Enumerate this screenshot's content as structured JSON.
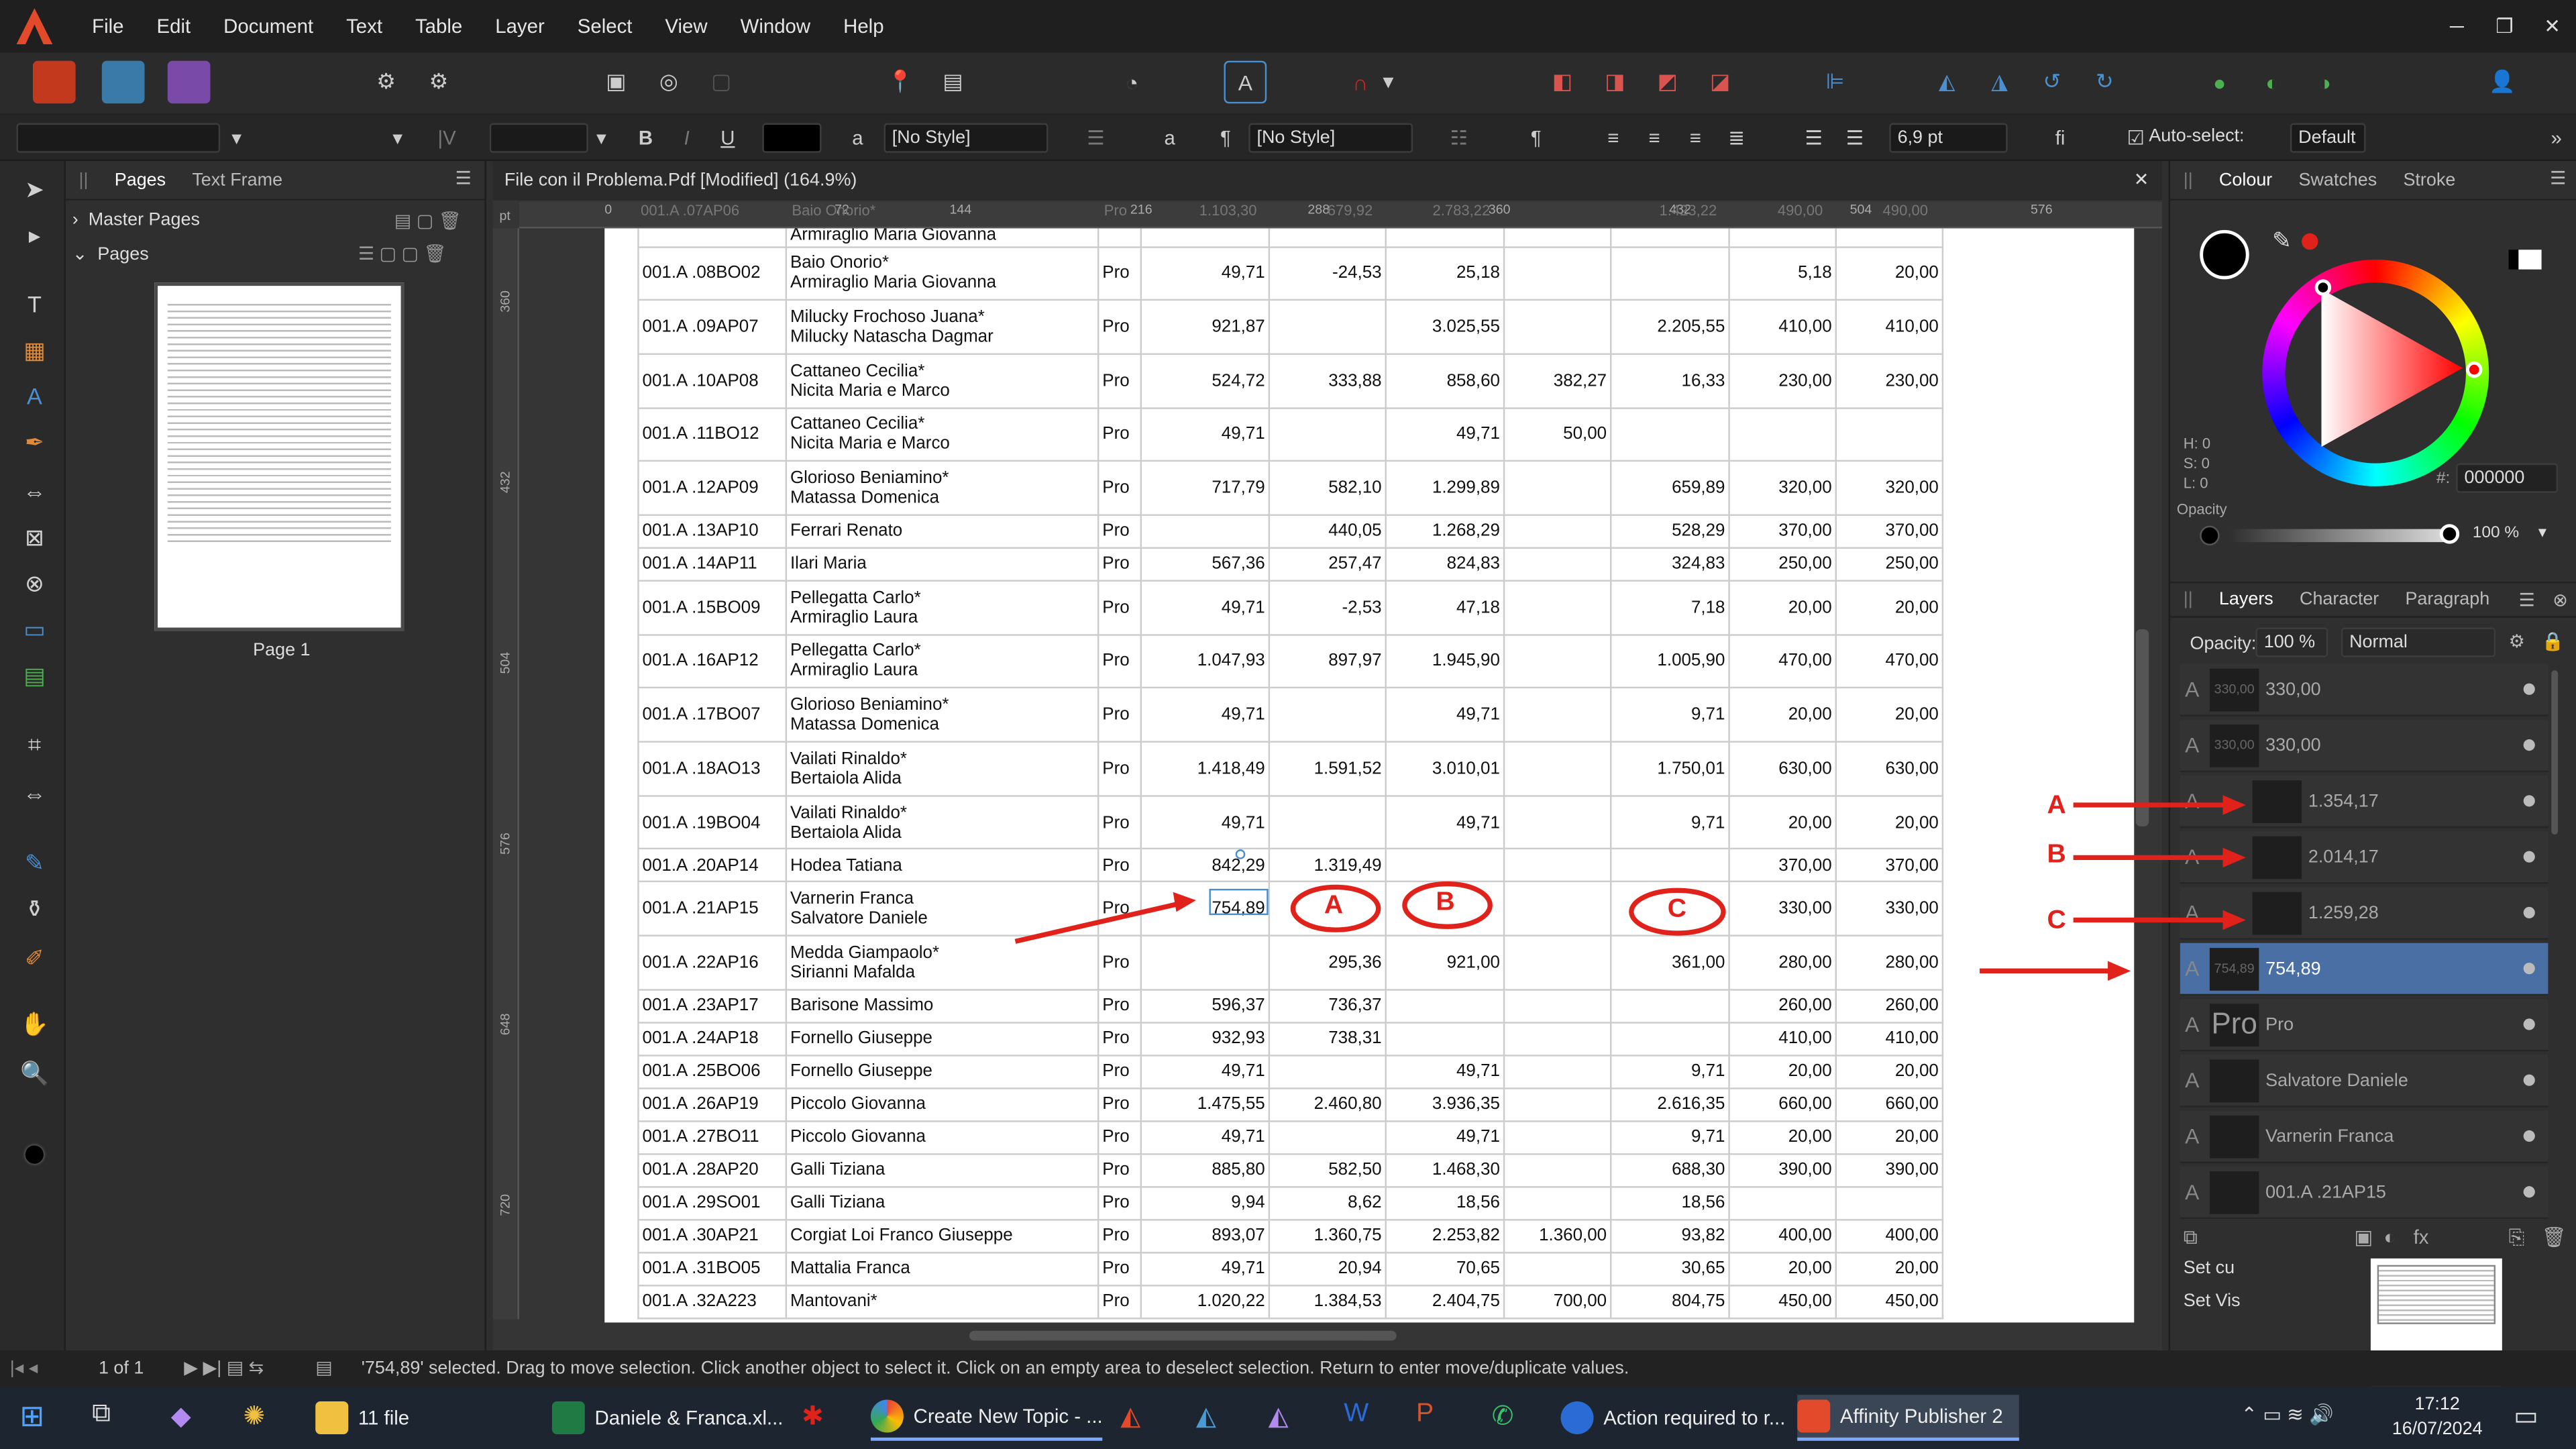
{
  "menu": {
    "items": [
      "File",
      "Edit",
      "Document",
      "Text",
      "Table",
      "Layer",
      "Select",
      "View",
      "Window",
      "Help"
    ]
  },
  "context": {
    "style1": "[No Style]",
    "style2": "[No Style]",
    "font_size": "6,9 pt",
    "autoselect_label": "Auto-select:",
    "autoselect_value": "Default"
  },
  "left_panel": {
    "tab1": "Pages",
    "tab2": "Text Frame",
    "master": "Master Pages",
    "pages": "Pages",
    "page_label": "Page 1"
  },
  "document": {
    "title": "File con il Problema.Pdf [Modified] (164.9%)",
    "ruler_unit": "pt",
    "hruler": [
      "0",
      "72",
      "144",
      "216",
      "288",
      "360",
      "432",
      "504",
      "576"
    ],
    "vruler": [
      "360",
      "432",
      "504",
      "576",
      "648",
      "720"
    ],
    "top_strip": [
      "001.A .07AP06",
      "Baio Onorio*",
      "Pro",
      "1.103,30",
      "679,92",
      "2.783,22",
      "1.423,22",
      "490,00",
      "490,00"
    ]
  },
  "table": {
    "rows": [
      {
        "code": "",
        "name1": "Armiraglio Maria Giovanna",
        "name2": "",
        "pro": "",
        "c1": "",
        "c2": "",
        "c3": "",
        "c4": "",
        "c5": "",
        "c6": "",
        "c7": ""
      },
      {
        "code": "001.A .08BO02",
        "name1": "Baio Onorio*",
        "name2": "Armiraglio Maria Giovanna",
        "pro": "Pro",
        "c1": "49,71",
        "c2": "-24,53",
        "c3": "25,18",
        "c4": "",
        "c5": "",
        "c6": "5,18",
        "c7": "20,00"
      },
      {
        "code": "001.A .09AP07",
        "name1": "Milucky Frochoso Juana*",
        "name2": "Milucky Natascha Dagmar",
        "pro": "Pro",
        "c1": "921,87",
        "c2": "",
        "c3": "3.025,55",
        "c4": "",
        "c5": "2.205,55",
        "c6": "410,00",
        "c7": "410,00"
      },
      {
        "code": "001.A .10AP08",
        "name1": "Cattaneo Cecilia*",
        "name2": "Nicita Maria e Marco",
        "pro": "Pro",
        "c1": "524,72",
        "c2": "333,88",
        "c3": "858,60",
        "c4": "382,27",
        "c5": "16,33",
        "c6": "230,00",
        "c7": "230,00"
      },
      {
        "code": "001.A .11BO12",
        "name1": "Cattaneo Cecilia*",
        "name2": "Nicita Maria e Marco",
        "pro": "Pro",
        "c1": "49,71",
        "c2": "",
        "c3": "49,71",
        "c4": "50,00",
        "c5": "",
        "c6": "",
        "c7": ""
      },
      {
        "code": "001.A .12AP09",
        "name1": "Glorioso Beniamino*",
        "name2": "Matassa Domenica",
        "pro": "Pro",
        "c1": "717,79",
        "c2": "582,10",
        "c3": "1.299,89",
        "c4": "",
        "c5": "659,89",
        "c6": "320,00",
        "c7": "320,00"
      },
      {
        "code": "001.A .13AP10",
        "name1": "Ferrari Renato",
        "name2": "",
        "pro": "Pro",
        "c1": "",
        "c2": "440,05",
        "c3": "1.268,29",
        "c4": "",
        "c5": "528,29",
        "c6": "370,00",
        "c7": "370,00"
      },
      {
        "code": "001.A .14AP11",
        "name1": "Ilari Maria",
        "name2": "",
        "pro": "Pro",
        "c1": "567,36",
        "c2": "257,47",
        "c3": "824,83",
        "c4": "",
        "c5": "324,83",
        "c6": "250,00",
        "c7": "250,00"
      },
      {
        "code": "001.A .15BO09",
        "name1": "Pellegatta Carlo*",
        "name2": "Armiraglio Laura",
        "pro": "Pro",
        "c1": "49,71",
        "c2": "-2,53",
        "c3": "47,18",
        "c4": "",
        "c5": "7,18",
        "c6": "20,00",
        "c7": "20,00"
      },
      {
        "code": "001.A .16AP12",
        "name1": "Pellegatta Carlo*",
        "name2": "Armiraglio Laura",
        "pro": "Pro",
        "c1": "1.047,93",
        "c2": "897,97",
        "c3": "1.945,90",
        "c4": "",
        "c5": "1.005,90",
        "c6": "470,00",
        "c7": "470,00"
      },
      {
        "code": "001.A .17BO07",
        "name1": "Glorioso Beniamino*",
        "name2": "Matassa Domenica",
        "pro": "Pro",
        "c1": "49,71",
        "c2": "",
        "c3": "49,71",
        "c4": "",
        "c5": "9,71",
        "c6": "20,00",
        "c7": "20,00"
      },
      {
        "code": "001.A .18AO13",
        "name1": "Vailati Rinaldo*",
        "name2": "Bertaiola Alida",
        "pro": "Pro",
        "c1": "1.418,49",
        "c2": "1.591,52",
        "c3": "3.010,01",
        "c4": "",
        "c5": "1.750,01",
        "c6": "630,00",
        "c7": "630,00"
      },
      {
        "code": "001.A .19BO04",
        "name1": "Vailati Rinaldo*",
        "name2": "Bertaiola Alida",
        "pro": "Pro",
        "c1": "49,71",
        "c2": "",
        "c3": "49,71",
        "c4": "",
        "c5": "9,71",
        "c6": "20,00",
        "c7": "20,00"
      },
      {
        "code": "001.A .20AP14",
        "name1": "Hodea Tatiana",
        "name2": "",
        "pro": "Pro",
        "c1": "842,29",
        "c2": "1.319,49",
        "c3": "",
        "c4": "",
        "c5": "",
        "c6": "370,00",
        "c7": "370,00"
      },
      {
        "code": "001.A .21AP15",
        "name1": "Varnerin Franca",
        "name2": "Salvatore Daniele",
        "pro": "Pro",
        "c1": "754,89",
        "c2": "",
        "c3": "",
        "c4": "",
        "c5": "",
        "c6": "330,00",
        "c7": "330,00"
      },
      {
        "code": "001.A .22AP16",
        "name1": "Medda Giampaolo*",
        "name2": "Sirianni Mafalda",
        "pro": "Pro",
        "c1": "",
        "c2": "295,36",
        "c3": "921,00",
        "c4": "",
        "c5": "361,00",
        "c6": "280,00",
        "c7": "280,00"
      },
      {
        "code": "001.A .23AP17",
        "name1": "Barisone Massimo",
        "name2": "",
        "pro": "Pro",
        "c1": "596,37",
        "c2": "736,37",
        "c3": "",
        "c4": "",
        "c5": "",
        "c6": "260,00",
        "c7": "260,00"
      },
      {
        "code": "001.A .24AP18",
        "name1": "Fornello Giuseppe",
        "name2": "",
        "pro": "Pro",
        "c1": "932,93",
        "c2": "738,31",
        "c3": "",
        "c4": "",
        "c5": "",
        "c6": "410,00",
        "c7": "410,00"
      },
      {
        "code": "001.A .25BO06",
        "name1": "Fornello Giuseppe",
        "name2": "",
        "pro": "Pro",
        "c1": "49,71",
        "c2": "",
        "c3": "49,71",
        "c4": "",
        "c5": "9,71",
        "c6": "20,00",
        "c7": "20,00"
      },
      {
        "code": "001.A .26AP19",
        "name1": "Piccolo Giovanna",
        "name2": "",
        "pro": "Pro",
        "c1": "1.475,55",
        "c2": "2.460,80",
        "c3": "3.936,35",
        "c4": "",
        "c5": "2.616,35",
        "c6": "660,00",
        "c7": "660,00"
      },
      {
        "code": "001.A .27BO11",
        "name1": "Piccolo Giovanna",
        "name2": "",
        "pro": "Pro",
        "c1": "49,71",
        "c2": "",
        "c3": "49,71",
        "c4": "",
        "c5": "9,71",
        "c6": "20,00",
        "c7": "20,00"
      },
      {
        "code": "001.A .28AP20",
        "name1": "Galli Tiziana",
        "name2": "",
        "pro": "Pro",
        "c1": "885,80",
        "c2": "582,50",
        "c3": "1.468,30",
        "c4": "",
        "c5": "688,30",
        "c6": "390,00",
        "c7": "390,00"
      },
      {
        "code": "001.A .29SO01",
        "name1": "Galli Tiziana",
        "name2": "",
        "pro": "Pro",
        "c1": "9,94",
        "c2": "8,62",
        "c3": "18,56",
        "c4": "",
        "c5": "18,56",
        "c6": "",
        "c7": ""
      },
      {
        "code": "001.A .30AP21",
        "name1": "Corgiat Loi Franco Giuseppe",
        "name2": "",
        "pro": "Pro",
        "c1": "893,07",
        "c2": "1.360,75",
        "c3": "2.253,82",
        "c4": "1.360,00",
        "c5": "93,82",
        "c6": "400,00",
        "c7": "400,00"
      },
      {
        "code": "001.A .31BO05",
        "name1": "Mattalia Franca",
        "name2": "",
        "pro": "Pro",
        "c1": "49,71",
        "c2": "20,94",
        "c3": "70,65",
        "c4": "",
        "c5": "30,65",
        "c6": "20,00",
        "c7": "20,00"
      },
      {
        "code": "001.A .32A223",
        "name1": "Mantovani*",
        "name2": "",
        "pro": "Pro",
        "c1": "1.020,22",
        "c2": "1.384,53",
        "c3": "2.404,75",
        "c4": "700,00",
        "c5": "804,75",
        "c6": "450,00",
        "c7": "450,00"
      }
    ]
  },
  "annotations": {
    "A": "A",
    "B": "B",
    "C": "C"
  },
  "right_panel": {
    "tabs": [
      "Colour",
      "Swatches",
      "Stroke"
    ],
    "hsl": [
      "H: 0",
      "S: 0",
      "L: 0"
    ],
    "hex_label": "#:",
    "hex": "000000",
    "opacity_label": "Opacity",
    "opacity": "100 %",
    "layer_tabs": [
      "Layers",
      "Character",
      "Paragraph"
    ],
    "layer_opacity_label": "Opacity:",
    "layer_opacity": "100 %",
    "blend": "Normal",
    "layers": [
      {
        "thumb": "330,00",
        "name": "330,00"
      },
      {
        "thumb": "330,00",
        "name": "330,00"
      },
      {
        "thumb": "",
        "name": "1.354,17"
      },
      {
        "thumb": "",
        "name": "2.014,17"
      },
      {
        "thumb": "",
        "name": "1.259,28"
      },
      {
        "thumb": "754,89",
        "name": "754,89"
      },
      {
        "thumb": "Pro",
        "name": "Pro"
      },
      {
        "thumb": "",
        "name": "Salvatore Daniele"
      },
      {
        "thumb": "",
        "name": "Varnerin Franca"
      },
      {
        "thumb": "",
        "name": "001.A .21AP15"
      }
    ],
    "nav1": "Set cu",
    "nav2": "Set Vis"
  },
  "status": {
    "pagecount": "1 of 1",
    "message": "'754,89' selected. Drag to move selection. Click another object to select it. Click on an empty area to deselect selection. Return to enter move/duplicate values."
  },
  "taskbar": {
    "items": [
      "11 file",
      "Daniele & Franca.xl...",
      "Create New Topic - ...",
      "Action required to r...",
      "Affinity Publisher 2"
    ],
    "time": "17:12",
    "date": "16/07/2024"
  },
  "colors": {
    "accent_red": "#e0221b",
    "selection": "#4a6fa5"
  }
}
